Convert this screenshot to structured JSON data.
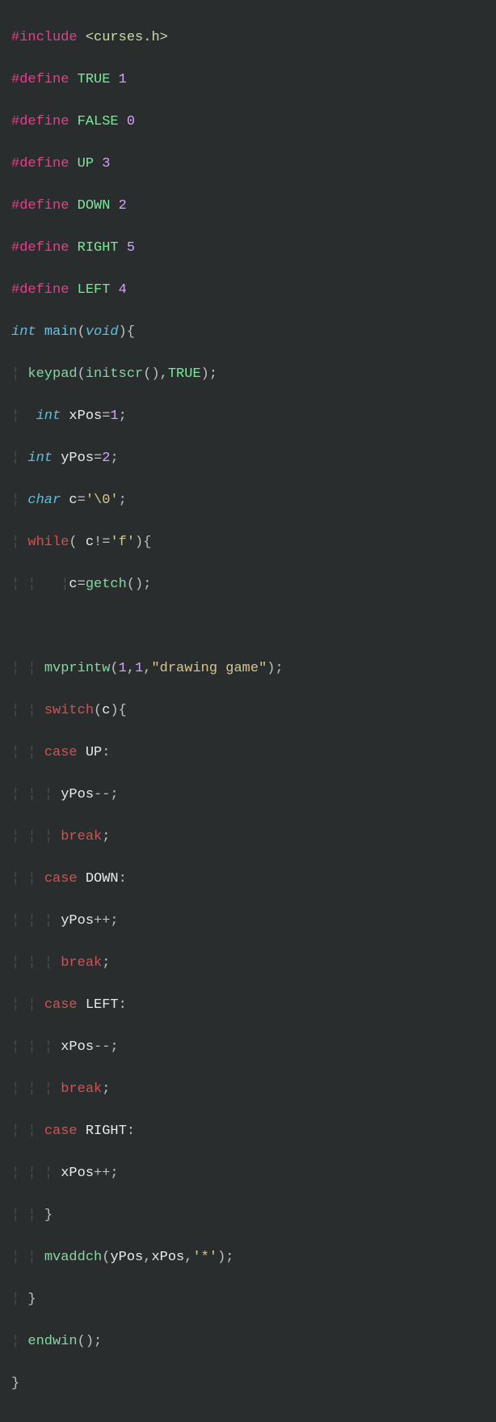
{
  "code": {
    "l1": {
      "inc": "#include",
      "hdr": "<curses.h>"
    },
    "l2": {
      "def": "#define",
      "name": "TRUE",
      "val": "1"
    },
    "l3": {
      "def": "#define",
      "name": "FALSE",
      "val": "0"
    },
    "l4": {
      "def": "#define",
      "name": "UP",
      "val": "3"
    },
    "l5": {
      "def": "#define",
      "name": "DOWN",
      "val": "2"
    },
    "l6": {
      "def": "#define",
      "name": "RIGHT",
      "val": "5"
    },
    "l7": {
      "def": "#define",
      "name": "LEFT",
      "val": "4"
    },
    "l8": {
      "type": "int",
      "fn": "main",
      "void": "void",
      "brace": "{"
    },
    "l9": {
      "call": "keypad",
      "call2": "initscr",
      "arg": "TRUE"
    },
    "l10": {
      "type": "int",
      "var": "xPos",
      "val": "1"
    },
    "l11": {
      "type": "int",
      "var": "yPos",
      "val": "2"
    },
    "l12": {
      "type": "char",
      "var": "c",
      "val": "'\\0'"
    },
    "l13": {
      "kw": "while",
      "c": "c",
      "ch": "'f'",
      "brace": "{"
    },
    "l14": {
      "guide1": "¦   ¦",
      "c": "c",
      "call": "getch"
    },
    "l15": {
      "txt": ""
    },
    "l16": {
      "call": "mvprintw",
      "n1": "1",
      "n2": "1",
      "str": "\"drawing game\""
    },
    "l17": {
      "kw": "switch",
      "c": "c",
      "brace": "{"
    },
    "l18": {
      "kw": "case",
      "m": "UP"
    },
    "l19": {
      "v": "yPos"
    },
    "l20": {
      "kw": "break"
    },
    "l21": {
      "kw": "case",
      "m": "DOWN"
    },
    "l22": {
      "v": "yPos"
    },
    "l23": {
      "kw": "break"
    },
    "l24": {
      "kw": "case",
      "m": "LEFT"
    },
    "l25": {
      "v": "xPos"
    },
    "l26": {
      "kw": "break"
    },
    "l27": {
      "kw": "case",
      "m": "RIGHT"
    },
    "l28": {
      "v": "xPos"
    },
    "l29": {
      "brace": "}"
    },
    "l30": {
      "call": "mvaddch",
      "a": "yPos",
      "b": "xPos",
      "ch": "'*'"
    },
    "l31": {
      "brace": "}"
    },
    "l32": {
      "call": "endwin"
    },
    "l33": {
      "brace": "}"
    }
  }
}
